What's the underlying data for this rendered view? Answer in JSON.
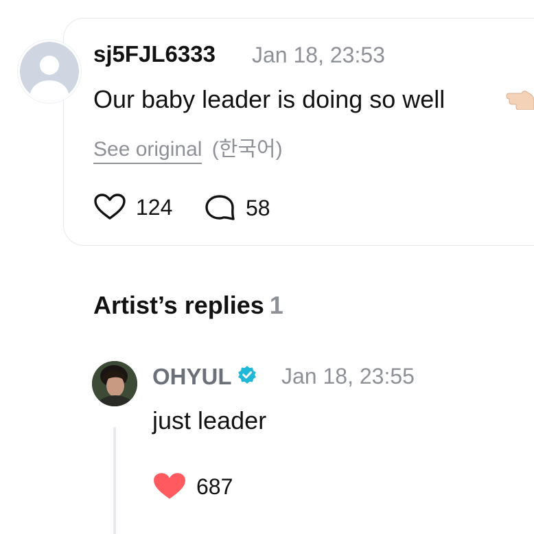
{
  "comment": {
    "username": "sj5FJL6333",
    "timestamp": "Jan 18, 23:53",
    "text": "Our baby leader is doing so well",
    "emoji": "pointing-left-hand-icon",
    "see_original_label": "See original",
    "original_language": "(한국어)",
    "likes": "124",
    "replies": "58"
  },
  "artist_replies": {
    "title": "Artist’s replies",
    "count": "1",
    "items": [
      {
        "artist_name": "OHYUL",
        "verified": true,
        "timestamp": "Jan 18, 23:55",
        "text": "just leader",
        "likes": "687"
      }
    ]
  },
  "colors": {
    "accent_verified": "#1fb8d6",
    "like_filled": "#ff5a5f",
    "muted_text": "#8d9096",
    "card_border": "#e7e8ec"
  }
}
